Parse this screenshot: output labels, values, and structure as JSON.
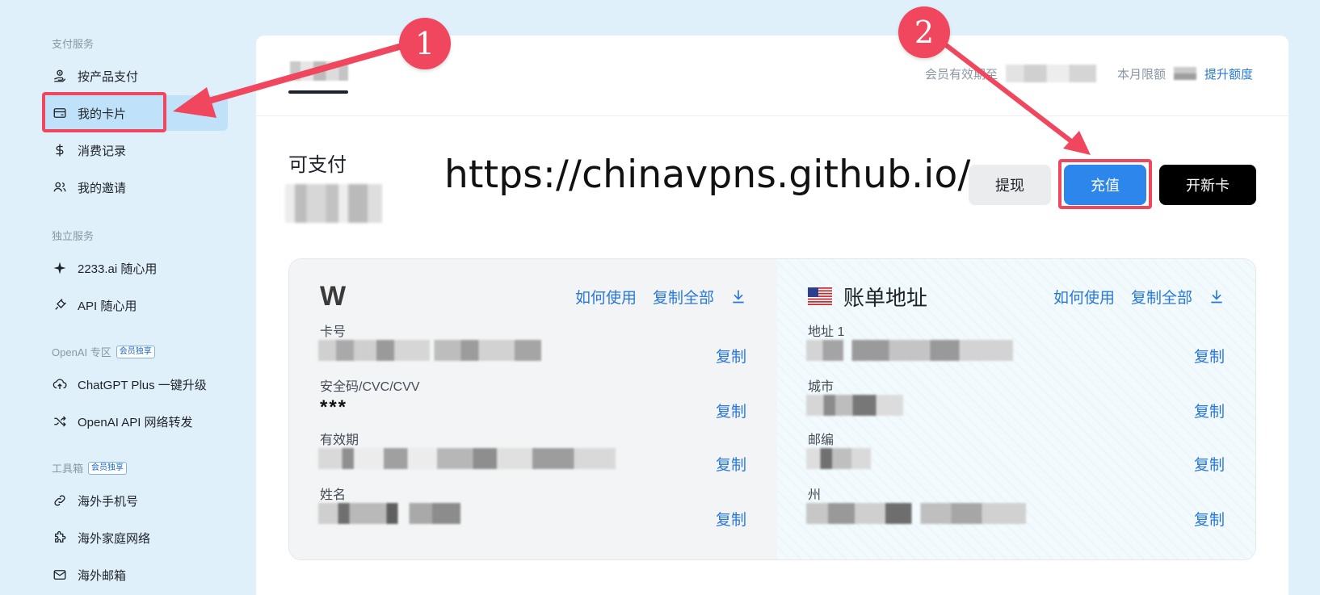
{
  "sidebar": {
    "sections": [
      {
        "title": "支付服务",
        "badge": ""
      },
      {
        "title": "独立服务",
        "badge": ""
      },
      {
        "title": "OpenAI 专区",
        "badge": "会员独享"
      },
      {
        "title": "工具箱",
        "badge": "会员独享"
      }
    ],
    "items": [
      {
        "label": "按产品支付",
        "icon": "pay-by-product-icon"
      },
      {
        "label": "我的卡片",
        "icon": "card-icon",
        "active": true
      },
      {
        "label": "消费记录",
        "icon": "dollar-icon"
      },
      {
        "label": "我的邀请",
        "icon": "users-icon"
      },
      {
        "label": "2233.ai 随心用",
        "icon": "sparkle-icon"
      },
      {
        "label": "API 随心用",
        "icon": "plug-icon"
      },
      {
        "label": "ChatGPT Plus 一键升级",
        "icon": "upgrade-icon"
      },
      {
        "label": "OpenAI API 网络转发",
        "icon": "shuffle-icon"
      },
      {
        "label": "海外手机号",
        "icon": "link-icon"
      },
      {
        "label": "海外家庭网络",
        "icon": "puzzle-icon"
      },
      {
        "label": "海外邮箱",
        "icon": "mail-icon"
      }
    ]
  },
  "header": {
    "membership_label": "会员有效期至",
    "limit_label": "本月限额",
    "upgrade_link": "提升额度"
  },
  "balance": {
    "title": "可支付"
  },
  "watermark_url": "https://chinavpns.github.io/",
  "buttons": {
    "withdraw": "提现",
    "recharge": "充值",
    "new_card": "开新卡"
  },
  "card": {
    "logo": "W",
    "how_to_use": "如何使用",
    "copy_all": "复制全部",
    "fields": [
      {
        "label": "卡号"
      },
      {
        "label": "安全码/CVC/CVV",
        "value": "***"
      },
      {
        "label": "有效期"
      },
      {
        "label": "姓名"
      }
    ],
    "copy_label": "复制"
  },
  "billing": {
    "title": "账单地址",
    "how_to_use": "如何使用",
    "copy_all": "复制全部",
    "fields": [
      {
        "label": "地址 1"
      },
      {
        "label": "城市"
      },
      {
        "label": "邮编"
      },
      {
        "label": "州"
      }
    ],
    "copy_label": "复制"
  },
  "annotations": {
    "step1": "1",
    "step2": "2",
    "color": "#f0475e"
  }
}
